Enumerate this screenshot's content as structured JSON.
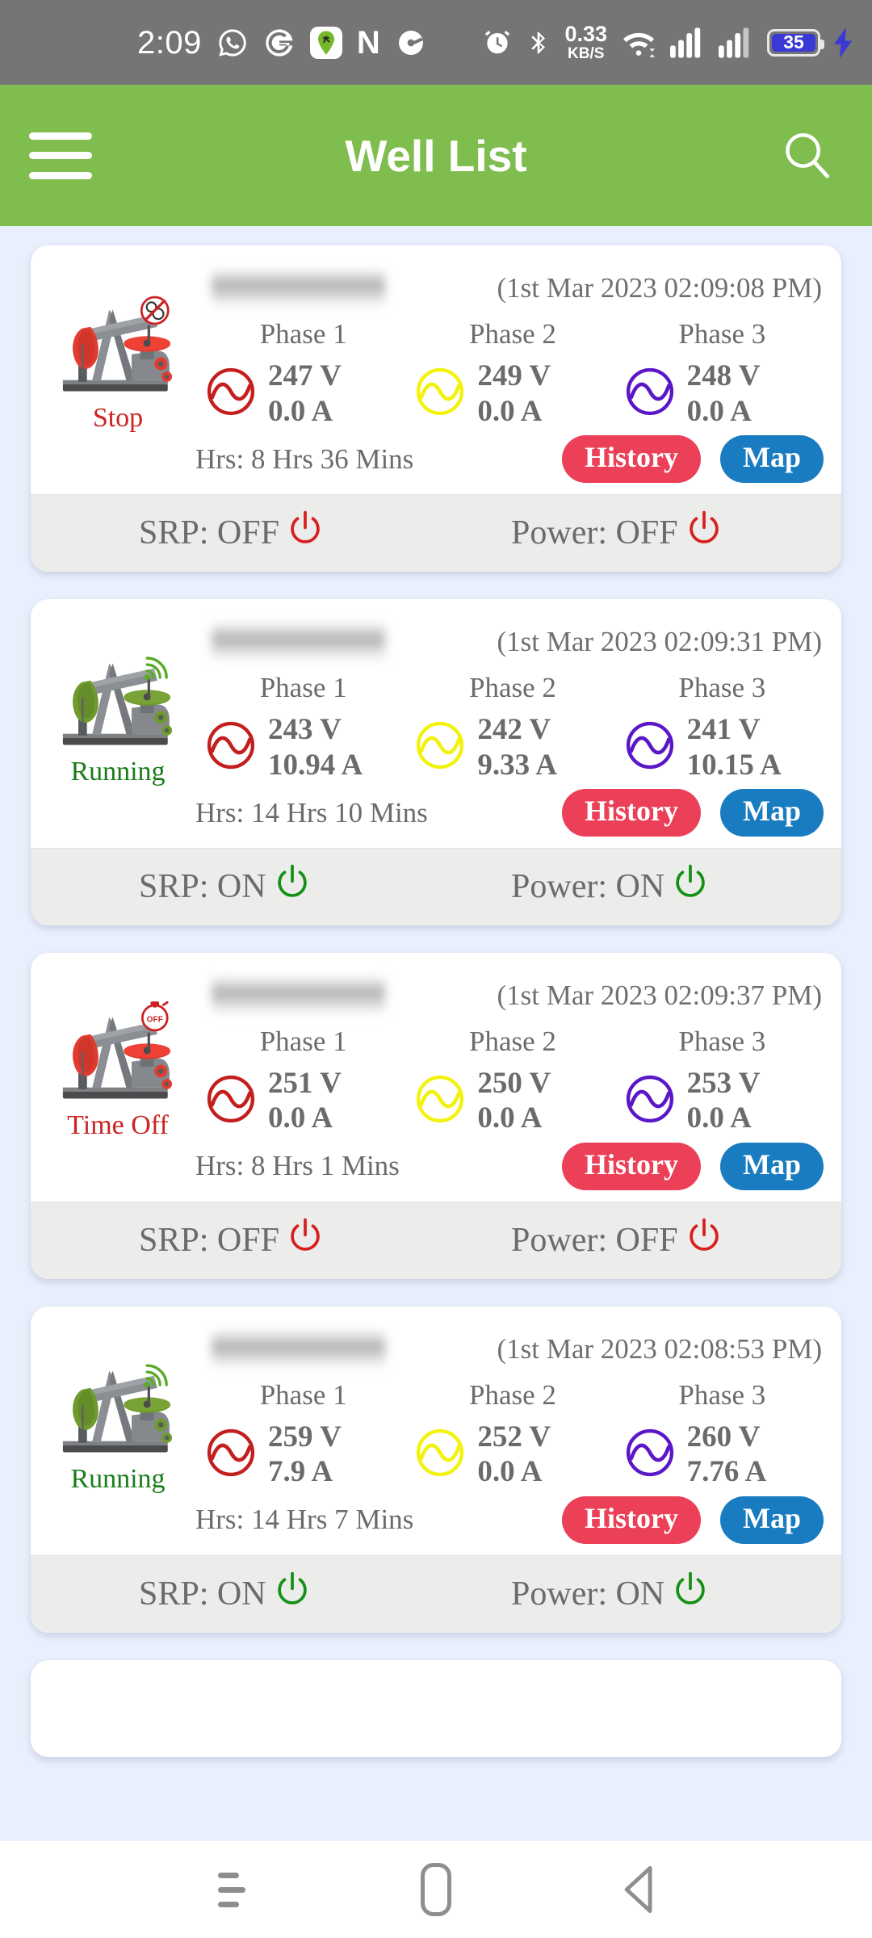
{
  "statusbar": {
    "time": "2:09",
    "app_icons": [
      "whatsapp-icon",
      "google-icon",
      "maps-icon",
      "netflix-icon",
      "media-icon"
    ],
    "alarm_icon": "alarm-icon",
    "bluetooth_icon": "bluetooth-icon",
    "net_speed_value": "0.33",
    "net_speed_unit": "KB/S",
    "wifi_icon": "wifi-icon",
    "signal_icons": [
      "signal-bars-icon",
      "signal-bars-icon"
    ],
    "battery_level": "35",
    "charging_icon": "charging-bolt-icon",
    "bg_color": "#757575"
  },
  "appbar": {
    "menu_icon": "hamburger-menu-icon",
    "title": "Well List",
    "search_icon": "search-icon",
    "bg_color": "#80bd4f"
  },
  "labels": {
    "phase1": "Phase 1",
    "phase2": "Phase 2",
    "phase3": "Phase 3",
    "history": "History",
    "map": "Map",
    "srp_prefix": "SRP: ",
    "power_prefix": "Power: "
  },
  "colors": {
    "phase1": "#c41e1e",
    "phase2": "#f2f20d",
    "phase3": "#5a16c8",
    "history_btn": "#ec4058",
    "map_btn": "#1a7cc0",
    "on": "#149014",
    "off": "#d81f1f",
    "running": "#1a7d1a",
    "stopped": "#cc2222",
    "page_bg": "#e9effc"
  },
  "cards": [
    {
      "status": "Stop",
      "status_color": "red",
      "pump_color": "red",
      "pump_badge": "no-gear-icon",
      "timestamp": "(1st Mar 2023 02:09:08 PM)",
      "phases": [
        {
          "volts": "247 V",
          "amps": "0.0 A"
        },
        {
          "volts": "249 V",
          "amps": "0.0 A"
        },
        {
          "volts": "248 V",
          "amps": "0.0 A"
        }
      ],
      "hours": "Hrs: 8 Hrs 36 Mins",
      "srp": "OFF",
      "power": "OFF",
      "srp_state": "off",
      "power_state": "off"
    },
    {
      "status": "Running",
      "status_color": "green",
      "pump_color": "green",
      "pump_badge": "signal-waves-icon",
      "timestamp": "(1st Mar 2023 02:09:31 PM)",
      "phases": [
        {
          "volts": "243 V",
          "amps": "10.94 A"
        },
        {
          "volts": "242 V",
          "amps": "9.33 A"
        },
        {
          "volts": "241 V",
          "amps": "10.15 A"
        }
      ],
      "hours": "Hrs: 14 Hrs 10 Mins",
      "srp": "ON",
      "power": "ON",
      "srp_state": "on",
      "power_state": "on"
    },
    {
      "status": "Time Off",
      "status_color": "red",
      "pump_color": "red",
      "pump_badge": "stopwatch-off-icon",
      "timestamp": "(1st Mar 2023 02:09:37 PM)",
      "phases": [
        {
          "volts": "251 V",
          "amps": "0.0 A"
        },
        {
          "volts": "250 V",
          "amps": "0.0 A"
        },
        {
          "volts": "253 V",
          "amps": "0.0 A"
        }
      ],
      "hours": "Hrs: 8 Hrs 1 Mins",
      "srp": "OFF",
      "power": "OFF",
      "srp_state": "off",
      "power_state": "off"
    },
    {
      "status": "Running",
      "status_color": "green",
      "pump_color": "green",
      "pump_badge": "signal-waves-icon",
      "timestamp": "(1st Mar 2023 02:08:53 PM)",
      "phases": [
        {
          "volts": "259 V",
          "amps": "7.9 A"
        },
        {
          "volts": "252 V",
          "amps": "0.0 A"
        },
        {
          "volts": "260 V",
          "amps": "7.76 A"
        }
      ],
      "hours": "Hrs: 14 Hrs 7 Mins",
      "srp": "ON",
      "power": "ON",
      "srp_state": "on",
      "power_state": "on"
    }
  ],
  "navbar": {
    "recents_icon": "recents-icon",
    "home_icon": "home-icon",
    "back_icon": "back-icon"
  }
}
